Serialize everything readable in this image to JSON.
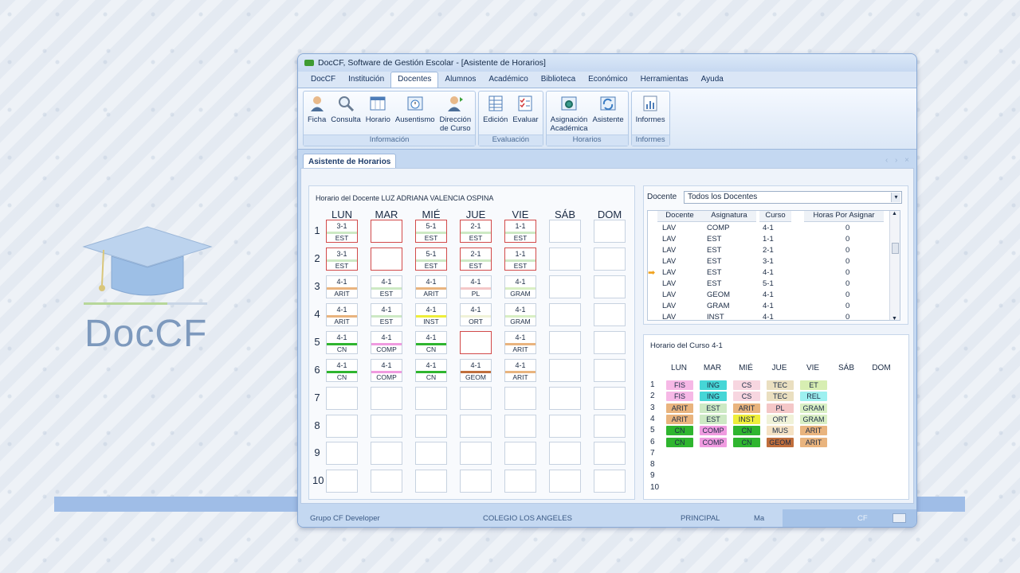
{
  "brand": {
    "logo_text": "DocCF"
  },
  "window": {
    "title": "DocCF, Software de Gestión Escolar  - [Asistente de Horarios]"
  },
  "menu": [
    "DocCF",
    "Institución",
    "Docentes",
    "Alumnos",
    "Académico",
    "Biblioteca",
    "Económico",
    "Herramientas",
    "Ayuda"
  ],
  "ribbon": {
    "groups": [
      {
        "label": "Información",
        "buttons": [
          {
            "label": "Ficha",
            "icon": "person-icon"
          },
          {
            "label": "Consulta",
            "icon": "magnifier-icon"
          },
          {
            "label": "Horario",
            "icon": "table-icon"
          },
          {
            "label": "Ausentismo",
            "icon": "clock-icon"
          },
          {
            "label": "Dirección\nde Curso",
            "icon": "teacher-icon"
          }
        ]
      },
      {
        "label": "Evaluación",
        "buttons": [
          {
            "label": "Edición",
            "icon": "grid-icon"
          },
          {
            "label": "Evaluar",
            "icon": "checklist-icon"
          }
        ]
      },
      {
        "label": "Horarios",
        "buttons": [
          {
            "label": "Asignación\nAcadémica",
            "icon": "gear-icon"
          },
          {
            "label": "Asistente",
            "icon": "sync-icon"
          }
        ]
      },
      {
        "label": "Informes",
        "buttons": [
          {
            "label": "Informes",
            "icon": "report-icon"
          }
        ]
      }
    ]
  },
  "doc_tab": "Asistente de Horarios",
  "teacher_schedule": {
    "title": "Horario del Docente  LUZ ADRIANA VALENCIA OSPINA",
    "days": [
      "LUN",
      "MAR",
      "MIÉ",
      "JUE",
      "VIE",
      "SÁB",
      "DOM"
    ],
    "rows": [
      "1",
      "2",
      "3",
      "4",
      "5",
      "6",
      "7",
      "8",
      "9",
      "10"
    ],
    "cells": [
      [
        {
          "t": "3-1",
          "s": "EST",
          "c": "#cde9c4",
          "sel": true
        },
        {
          "t": "",
          "s": "",
          "c": "",
          "sel": true
        },
        {
          "t": "5-1",
          "s": "EST",
          "c": "#cde9c4",
          "sel": true
        },
        {
          "t": "2-1",
          "s": "EST",
          "c": "#cde9c4",
          "sel": true
        },
        {
          "t": "1-1",
          "s": "EST",
          "c": "#cde9c4",
          "sel": true
        },
        null,
        null
      ],
      [
        {
          "t": "3-1",
          "s": "EST",
          "c": "#cde9c4",
          "sel": true
        },
        {
          "t": "",
          "s": "",
          "c": "",
          "sel": true
        },
        {
          "t": "5-1",
          "s": "EST",
          "c": "#cde9c4",
          "sel": true
        },
        {
          "t": "2-1",
          "s": "EST",
          "c": "#cde9c4",
          "sel": true
        },
        {
          "t": "1-1",
          "s": "EST",
          "c": "#cde9c4",
          "sel": true
        },
        null,
        null
      ],
      [
        {
          "t": "4-1",
          "s": "ARIT",
          "c": "#e9b47e"
        },
        {
          "t": "4-1",
          "s": "EST",
          "c": "#cde9c4"
        },
        {
          "t": "4-1",
          "s": "ARIT",
          "c": "#e9b47e"
        },
        {
          "t": "4-1",
          "s": "PL",
          "c": "#f4c7c7"
        },
        {
          "t": "4-1",
          "s": "GRAM",
          "c": "#d9efc4"
        },
        null,
        null
      ],
      [
        {
          "t": "4-1",
          "s": "ARIT",
          "c": "#e9b47e"
        },
        {
          "t": "4-1",
          "s": "EST",
          "c": "#cde9c4"
        },
        {
          "t": "4-1",
          "s": "INST",
          "c": "#eeee3a"
        },
        {
          "t": "4-1",
          "s": "ORT",
          "c": "#f0f2d8"
        },
        {
          "t": "4-1",
          "s": "GRAM",
          "c": "#d9efc4"
        },
        null,
        null
      ],
      [
        {
          "t": "4-1",
          "s": "CN",
          "c": "#2fb52f"
        },
        {
          "t": "4-1",
          "s": "COMP",
          "c": "#f09be0"
        },
        {
          "t": "4-1",
          "s": "CN",
          "c": "#2fb52f"
        },
        {
          "t": "",
          "s": "",
          "c": "",
          "sel": true
        },
        {
          "t": "4-1",
          "s": "ARIT",
          "c": "#e9b47e"
        },
        null,
        null
      ],
      [
        {
          "t": "4-1",
          "s": "CN",
          "c": "#2fb52f"
        },
        {
          "t": "4-1",
          "s": "COMP",
          "c": "#f09be0"
        },
        {
          "t": "4-1",
          "s": "CN",
          "c": "#2fb52f"
        },
        {
          "t": "4-1",
          "s": "GEOM",
          "c": "#c06e3c"
        },
        {
          "t": "4-1",
          "s": "ARIT",
          "c": "#e9b47e"
        },
        null,
        null
      ]
    ]
  },
  "filter": {
    "label": "Docente",
    "value": "Todos los Docentes"
  },
  "assignments": {
    "columns": [
      "Docente",
      "Asignatura",
      "Curso",
      "Horas Por Asignar"
    ],
    "rows": [
      [
        "LAV",
        "COMP",
        "4-1",
        "0"
      ],
      [
        "LAV",
        "EST",
        "1-1",
        "0"
      ],
      [
        "LAV",
        "EST",
        "2-1",
        "0"
      ],
      [
        "LAV",
        "EST",
        "3-1",
        "0"
      ],
      [
        "LAV",
        "EST",
        "4-1",
        "0"
      ],
      [
        "LAV",
        "EST",
        "5-1",
        "0"
      ],
      [
        "LAV",
        "GEOM",
        "4-1",
        "0"
      ],
      [
        "LAV",
        "GRAM",
        "4-1",
        "0"
      ],
      [
        "LAV",
        "INST",
        "4-1",
        "0"
      ]
    ],
    "current_row": 4
  },
  "course_schedule": {
    "title": "Horario del Curso  4-1",
    "days": [
      "LUN",
      "MAR",
      "MIÉ",
      "JUE",
      "VIE",
      "SÁB",
      "DOM"
    ],
    "rows": [
      "1",
      "2",
      "3",
      "4",
      "5",
      "6",
      "7",
      "8",
      "9",
      "10"
    ],
    "cells": [
      [
        [
          "FIS",
          "#f6b8e6"
        ],
        [
          "ING",
          "#46d6d6"
        ],
        [
          "CS",
          "#f7d6e0"
        ],
        [
          "TEC",
          "#eadfc0"
        ],
        [
          "ET",
          "#d7eeb2"
        ]
      ],
      [
        [
          "FIS",
          "#f6b8e6"
        ],
        [
          "ING",
          "#46d6d6"
        ],
        [
          "CS",
          "#f7d6e0"
        ],
        [
          "TEC",
          "#eadfc0"
        ],
        [
          "REL",
          "#9df0f0"
        ]
      ],
      [
        [
          "ARIT",
          "#e9b47e"
        ],
        [
          "EST",
          "#cde9c4"
        ],
        [
          "ARIT",
          "#e9b47e"
        ],
        [
          "PL",
          "#f4c7c7"
        ],
        [
          "GRAM",
          "#d9efc4"
        ]
      ],
      [
        [
          "ARIT",
          "#e9b47e"
        ],
        [
          "EST",
          "#cde9c4"
        ],
        [
          "INST",
          "#eeee3a"
        ],
        [
          "ORT",
          "#f0f2d8"
        ],
        [
          "GRAM",
          "#d9efc4"
        ]
      ],
      [
        [
          "CN",
          "#2fb52f"
        ],
        [
          "COMP",
          "#f09be0"
        ],
        [
          "CN",
          "#2fb52f"
        ],
        [
          "MUS",
          "#f5e2c4"
        ],
        [
          "ARIT",
          "#e9b47e"
        ]
      ],
      [
        [
          "CN",
          "#2fb52f"
        ],
        [
          "COMP",
          "#f09be0"
        ],
        [
          "CN",
          "#2fb52f"
        ],
        [
          "GEOM",
          "#c06e3c"
        ],
        [
          "ARIT",
          "#e9b47e"
        ]
      ]
    ]
  },
  "status": {
    "group": "Grupo CF Developer",
    "school": "COLEGIO LOS ANGELES",
    "branch": "PRINCIPAL",
    "user": "Ma",
    "code": "CF"
  }
}
